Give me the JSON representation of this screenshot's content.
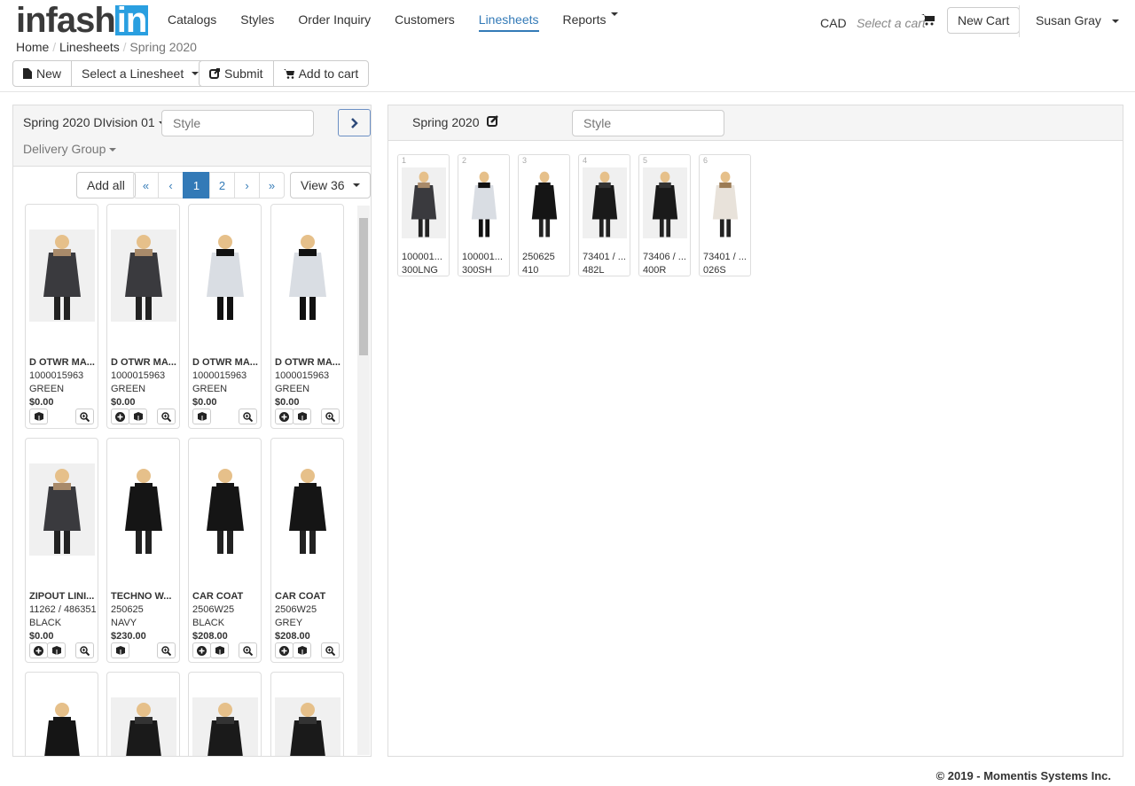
{
  "logo": {
    "text_a": "infash",
    "text_b": "in"
  },
  "nav": [
    {
      "label": "Catalogs"
    },
    {
      "label": "Styles"
    },
    {
      "label": "Order Inquiry"
    },
    {
      "label": "Customers"
    },
    {
      "label": "Linesheets",
      "active": true
    },
    {
      "label": "Reports"
    }
  ],
  "header": {
    "currency": "CAD",
    "cart_placeholder": "Select a cart",
    "new_cart": "New Cart",
    "user": "Susan Gray"
  },
  "breadcrumb": [
    "Home",
    "Linesheets",
    "Spring 2020"
  ],
  "toolbar": {
    "new": "New",
    "select": "Select a Linesheet",
    "submit": "Submit",
    "add_to_cart": "Add to cart"
  },
  "left": {
    "division": "Spring 2020 DIvision 01",
    "style_placeholder": "Style",
    "delivery": "Delivery Group",
    "add_all": "Add all",
    "pages": [
      "«",
      "‹",
      "1",
      "2",
      "›",
      "»"
    ],
    "view": "View 36"
  },
  "products": [
    {
      "name": "D OTWR MA...",
      "style": "1000015963",
      "color": "GREEN",
      "price": "$0.00",
      "add": false,
      "img": "parka"
    },
    {
      "name": "D OTWR MA...",
      "style": "1000015963",
      "color": "GREEN",
      "price": "$0.00",
      "add": true,
      "img": "parka"
    },
    {
      "name": "D OTWR MA...",
      "style": "1000015963",
      "color": "GREEN",
      "price": "$0.00",
      "add": false,
      "img": "top"
    },
    {
      "name": "D OTWR MA...",
      "style": "1000015963",
      "color": "GREEN",
      "price": "$0.00",
      "add": true,
      "img": "top"
    },
    {
      "name": "ZIPOUT LINI...",
      "style": "11262 / 486351",
      "color": "BLACK",
      "price": "$0.00",
      "add": true,
      "img": "parka"
    },
    {
      "name": "TECHNO W...",
      "style": "250625",
      "color": "NAVY",
      "price": "$230.00",
      "add": false,
      "img": "black"
    },
    {
      "name": "CAR COAT",
      "style": "2506W25",
      "color": "BLACK",
      "price": "$208.00",
      "add": true,
      "img": "black"
    },
    {
      "name": "CAR COAT",
      "style": "2506W25",
      "color": "GREY",
      "price": "$208.00",
      "add": true,
      "img": "black"
    },
    {
      "img": "black"
    },
    {
      "img": "blazer"
    },
    {
      "img": "blazer"
    },
    {
      "img": "blazer"
    }
  ],
  "right": {
    "title": "Spring 2020",
    "style_placeholder": "Style",
    "items": [
      {
        "n": "1",
        "a": "100001...",
        "b": "300LNG",
        "img": "parka"
      },
      {
        "n": "2",
        "a": "100001...",
        "b": "300SH",
        "img": "top"
      },
      {
        "n": "3",
        "a": "250625",
        "b": "410",
        "img": "black"
      },
      {
        "n": "4",
        "a": "73401 / ...",
        "b": "482L",
        "img": "blazer"
      },
      {
        "n": "5",
        "a": "73406 / ...",
        "b": "400R",
        "img": "blazer"
      },
      {
        "n": "6",
        "a": "73401 / ...",
        "b": "026S",
        "img": "white"
      }
    ]
  },
  "footer": "© 2019 - Momentis Systems Inc."
}
